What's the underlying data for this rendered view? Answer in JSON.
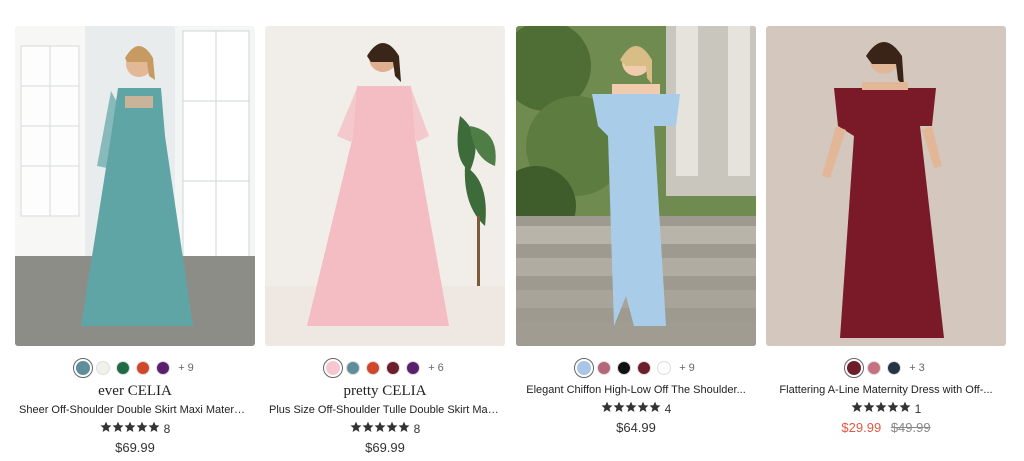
{
  "products": [
    {
      "brand": "ever CELIA",
      "name": "Sheer Off-Shoulder Double Skirt Maxi Maternity...",
      "rating_value": 5,
      "review_count": "8",
      "price": "$69.99",
      "more_colors": "+ 9",
      "swatches": [
        "#5f8d99",
        "#f1f1ec",
        "#1f6b45",
        "#d0472c",
        "#5a1f6e"
      ],
      "selected_swatch": 0,
      "dress_color": "#5fa5a6"
    },
    {
      "brand": "pretty CELIA",
      "name": "Plus Size Off-Shoulder Tulle Double Skirt Maxi...",
      "rating_value": 5,
      "review_count": "8",
      "price": "$69.99",
      "more_colors": "+ 6",
      "swatches": [
        "#f6c7cf",
        "#5f8d99",
        "#d0472c",
        "#6e1e2a",
        "#5a1f6e"
      ],
      "selected_swatch": 0,
      "dress_color": "#f4bcc3"
    },
    {
      "brand": "",
      "name": "Elegant Chiffon High-Low Off The Shoulder...",
      "rating_value": 5,
      "review_count": "4",
      "price": "$64.99",
      "more_colors": "+ 9",
      "swatches": [
        "#a9c6e8",
        "#b5667a",
        "#111111",
        "#6e1e2a",
        "#ffffff"
      ],
      "selected_swatch": 0,
      "dress_color": "#a9cde8"
    },
    {
      "brand": "",
      "name": "Flattering A-Line Maternity Dress with Off-...",
      "rating_value": 5,
      "review_count": "1",
      "sale_price": "$29.99",
      "original_price": "$49.99",
      "more_colors": "+ 3",
      "swatches": [
        "#6e1e2a",
        "#c5717f",
        "#243447"
      ],
      "selected_swatch": 0,
      "dress_color": "#7a1a28"
    }
  ],
  "colors": {
    "sale": "#e05a44",
    "star": "#333333"
  }
}
